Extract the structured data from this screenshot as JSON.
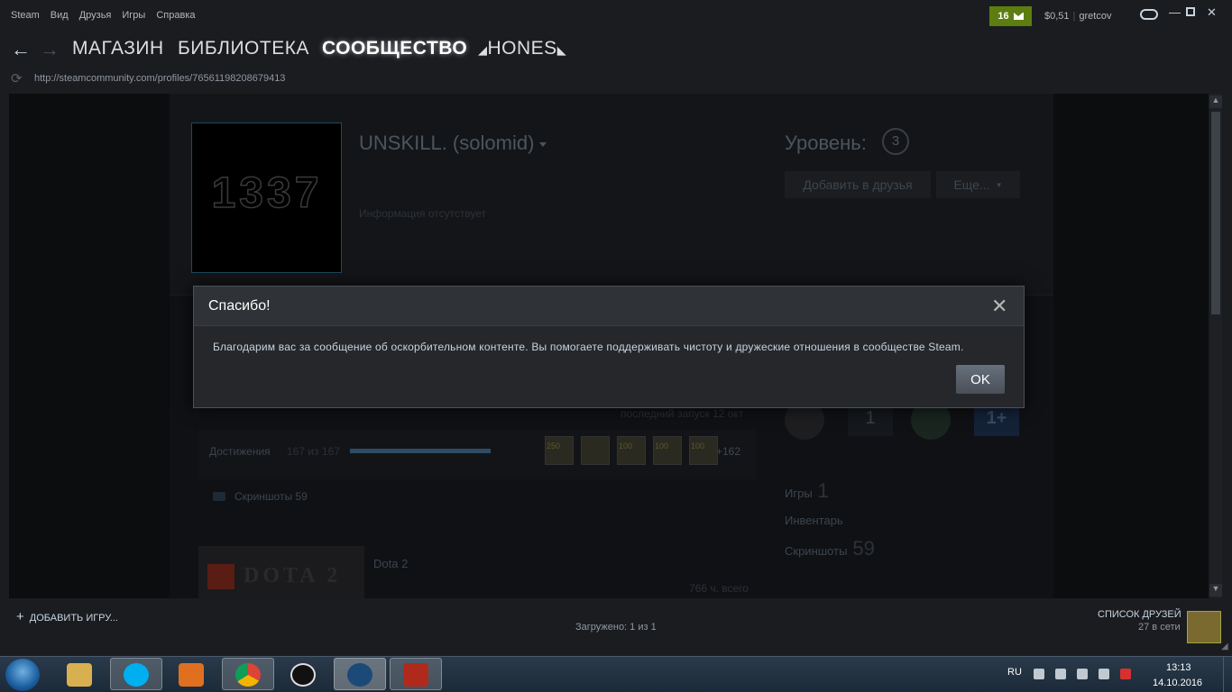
{
  "menu": {
    "items": [
      "Steam",
      "Вид",
      "Друзья",
      "Игры",
      "Справка"
    ]
  },
  "account": {
    "notifications": "16",
    "balance": "$0,51",
    "username": "gretcov"
  },
  "nav": {
    "tabs": [
      "МАГАЗИН",
      "БИБЛИОТЕКА",
      "СООБЩЕСТВО",
      "HONES"
    ],
    "active_tab": "СООБЩЕСТВО"
  },
  "url": "http://steamcommunity.com/profiles/76561198208679413",
  "profile": {
    "avatar_text": "1337",
    "persona_name": "UNSKILL. (solomid)",
    "info": "Информация отсутствует",
    "level_label": "Уровень:",
    "level": "3",
    "add_friend": "Добавить в друзья",
    "more": "Еще..."
  },
  "recent_game": {
    "last_launch": "последний запуск 12 окт",
    "achievements_label": "Достижения",
    "achievements_count": "167 из 167",
    "achievement_progress": 1.0,
    "achievement_icons": [
      "250",
      "",
      "100",
      "100",
      "100"
    ],
    "achievements_more": "+162",
    "screenshots": "Скриншоты 59"
  },
  "second_game": {
    "logo_text": "DOTA 2",
    "title": "Dota 2",
    "hours": "766 ч. всего"
  },
  "sidebar_stats": [
    {
      "label": "Игры",
      "value": "1"
    },
    {
      "label": "Инвентарь",
      "value": ""
    },
    {
      "label": "Скриншоты",
      "value": "59"
    }
  ],
  "badge_number": "1",
  "badge_plus": "1+",
  "dialog": {
    "title": "Спасибо!",
    "message": "Благодарим вас за сообщение об оскорбительном контенте. Вы помогаете поддерживать чистоту и дружеские отношения в сообществе Steam.",
    "ok": "OK"
  },
  "bottom": {
    "add_game": "ДОБАВИТЬ ИГРУ...",
    "loaded": "Загружено: 1 из 1",
    "friends_list": "СПИСОК ДРУЗЕЙ",
    "friends_online": "27 в сети"
  },
  "taskbar": {
    "language": "RU",
    "time": "13:13",
    "date": "14.10.2016",
    "apps": [
      "file-explorer",
      "skype",
      "media-player",
      "chrome",
      "steam-alt",
      "steam",
      "dota2"
    ]
  },
  "colors": {
    "notification_green": "#5c7e10",
    "dialog_bg": "#25272b",
    "ok_button": "#5a626c",
    "link_blue": "#1d4a5a"
  }
}
